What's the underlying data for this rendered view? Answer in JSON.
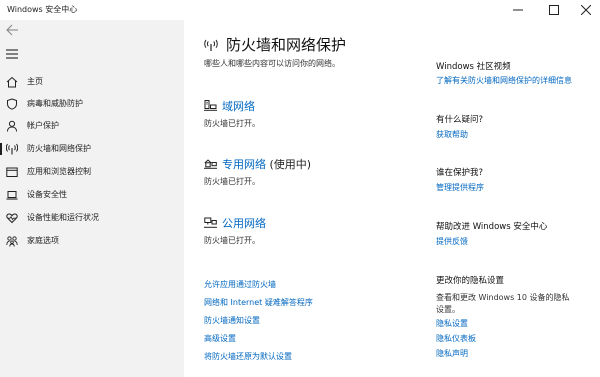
{
  "window": {
    "title": "Windows 安全中心"
  },
  "sidebar": {
    "items": [
      {
        "label": "主页",
        "icon": "home-icon"
      },
      {
        "label": "病毒和威胁防护",
        "icon": "shield-icon"
      },
      {
        "label": "帐户保护",
        "icon": "person-icon"
      },
      {
        "label": "防火墙和网络保护",
        "icon": "antenna-icon",
        "active": true
      },
      {
        "label": "应用和浏览器控制",
        "icon": "app-window-icon"
      },
      {
        "label": "设备安全性",
        "icon": "laptop-icon"
      },
      {
        "label": "设备性能和运行状况",
        "icon": "heart-icon"
      },
      {
        "label": "家庭选项",
        "icon": "family-icon"
      }
    ]
  },
  "main": {
    "title": "防火墙和网络保护",
    "subtitle": "哪些人和哪些内容可以访问你的网络。",
    "networks": [
      {
        "name": "域网络",
        "suffix": "",
        "status": "防火墙已打开。",
        "icon": "domain-network-icon"
      },
      {
        "name": "专用网络",
        "suffix": " (使用中)",
        "status": "防火墙已打开。",
        "icon": "private-network-icon"
      },
      {
        "name": "公用网络",
        "suffix": "",
        "status": "防火墙已打开。",
        "icon": "public-network-icon"
      }
    ],
    "links": [
      "允许应用通过防火墙",
      "网络和 Internet 疑难解答程序",
      "防火墙通知设置",
      "高级设置",
      "将防火墙还原为默认设置"
    ]
  },
  "right": {
    "video_heading": "Windows 社区视频",
    "video_link": "了解有关防火墙和网络保护的详细信息",
    "question_heading": "有什么疑问?",
    "question_link": "获取帮助",
    "protect_heading": "谁在保护我?",
    "protect_link": "管理提供程序",
    "improve_heading": "帮助改进 Windows 安全中心",
    "improve_link": "提供反馈",
    "privacy_heading": "更改你的隐私设置",
    "privacy_text_1": "查看和更改 Windows 10 设备的隐私",
    "privacy_text_2": "设置。",
    "privacy_links": [
      "隐私设置",
      "隐私仪表板",
      "隐私声明"
    ]
  },
  "colors": {
    "accent": "#0067c0",
    "sidebar_bg": "#f2f2f2"
  }
}
